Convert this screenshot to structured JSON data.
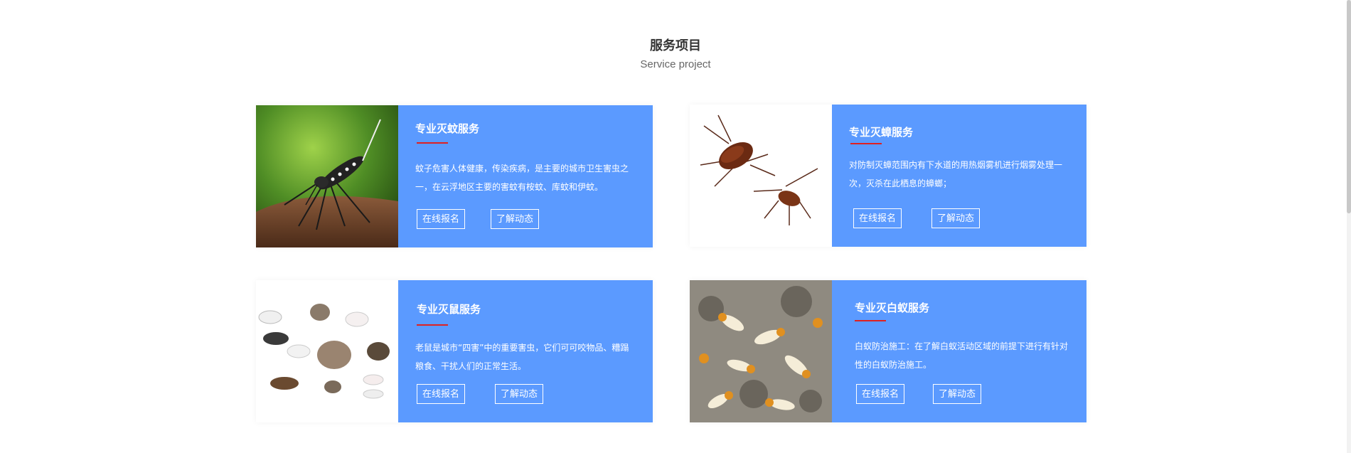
{
  "section": {
    "title": "服务项目",
    "subtitle": "Service project"
  },
  "cards": [
    {
      "title": "专业灭蚊服务",
      "description": "蚊子危害人体健康，传染疾病，是主要的城市卫生害虫之一，在云浮地区主要的害蚊有桉蚊、库蚊和伊蚊。",
      "image": "mosquito-photo"
    },
    {
      "title": "专业灭蟑服务",
      "description": "对防制灭蟑范围内有下水道的用热烟雾机进行烟雾处理一次，灭杀在此栖息的蟑螂；",
      "image": "cockroach-photo"
    },
    {
      "title": "专业灭鼠服务",
      "description": "老鼠是城市“四害”中的重要害虫，它们可可咬物品、糟蹋粮食、干扰人们的正常生活。",
      "image": "rats-photo"
    },
    {
      "title": "专业灭白蚁服务",
      "description": "白蚁防治施工：在了解白蚁活动区域的前提下进行有针对性的白蚁防治施工。",
      "image": "termites-photo"
    }
  ],
  "buttons": {
    "signup_label": "在线报名",
    "news_label": "了解动态"
  },
  "colors": {
    "card_background": "#5b9aff",
    "title_underline": "#e02020",
    "heading_text": "#333333"
  }
}
